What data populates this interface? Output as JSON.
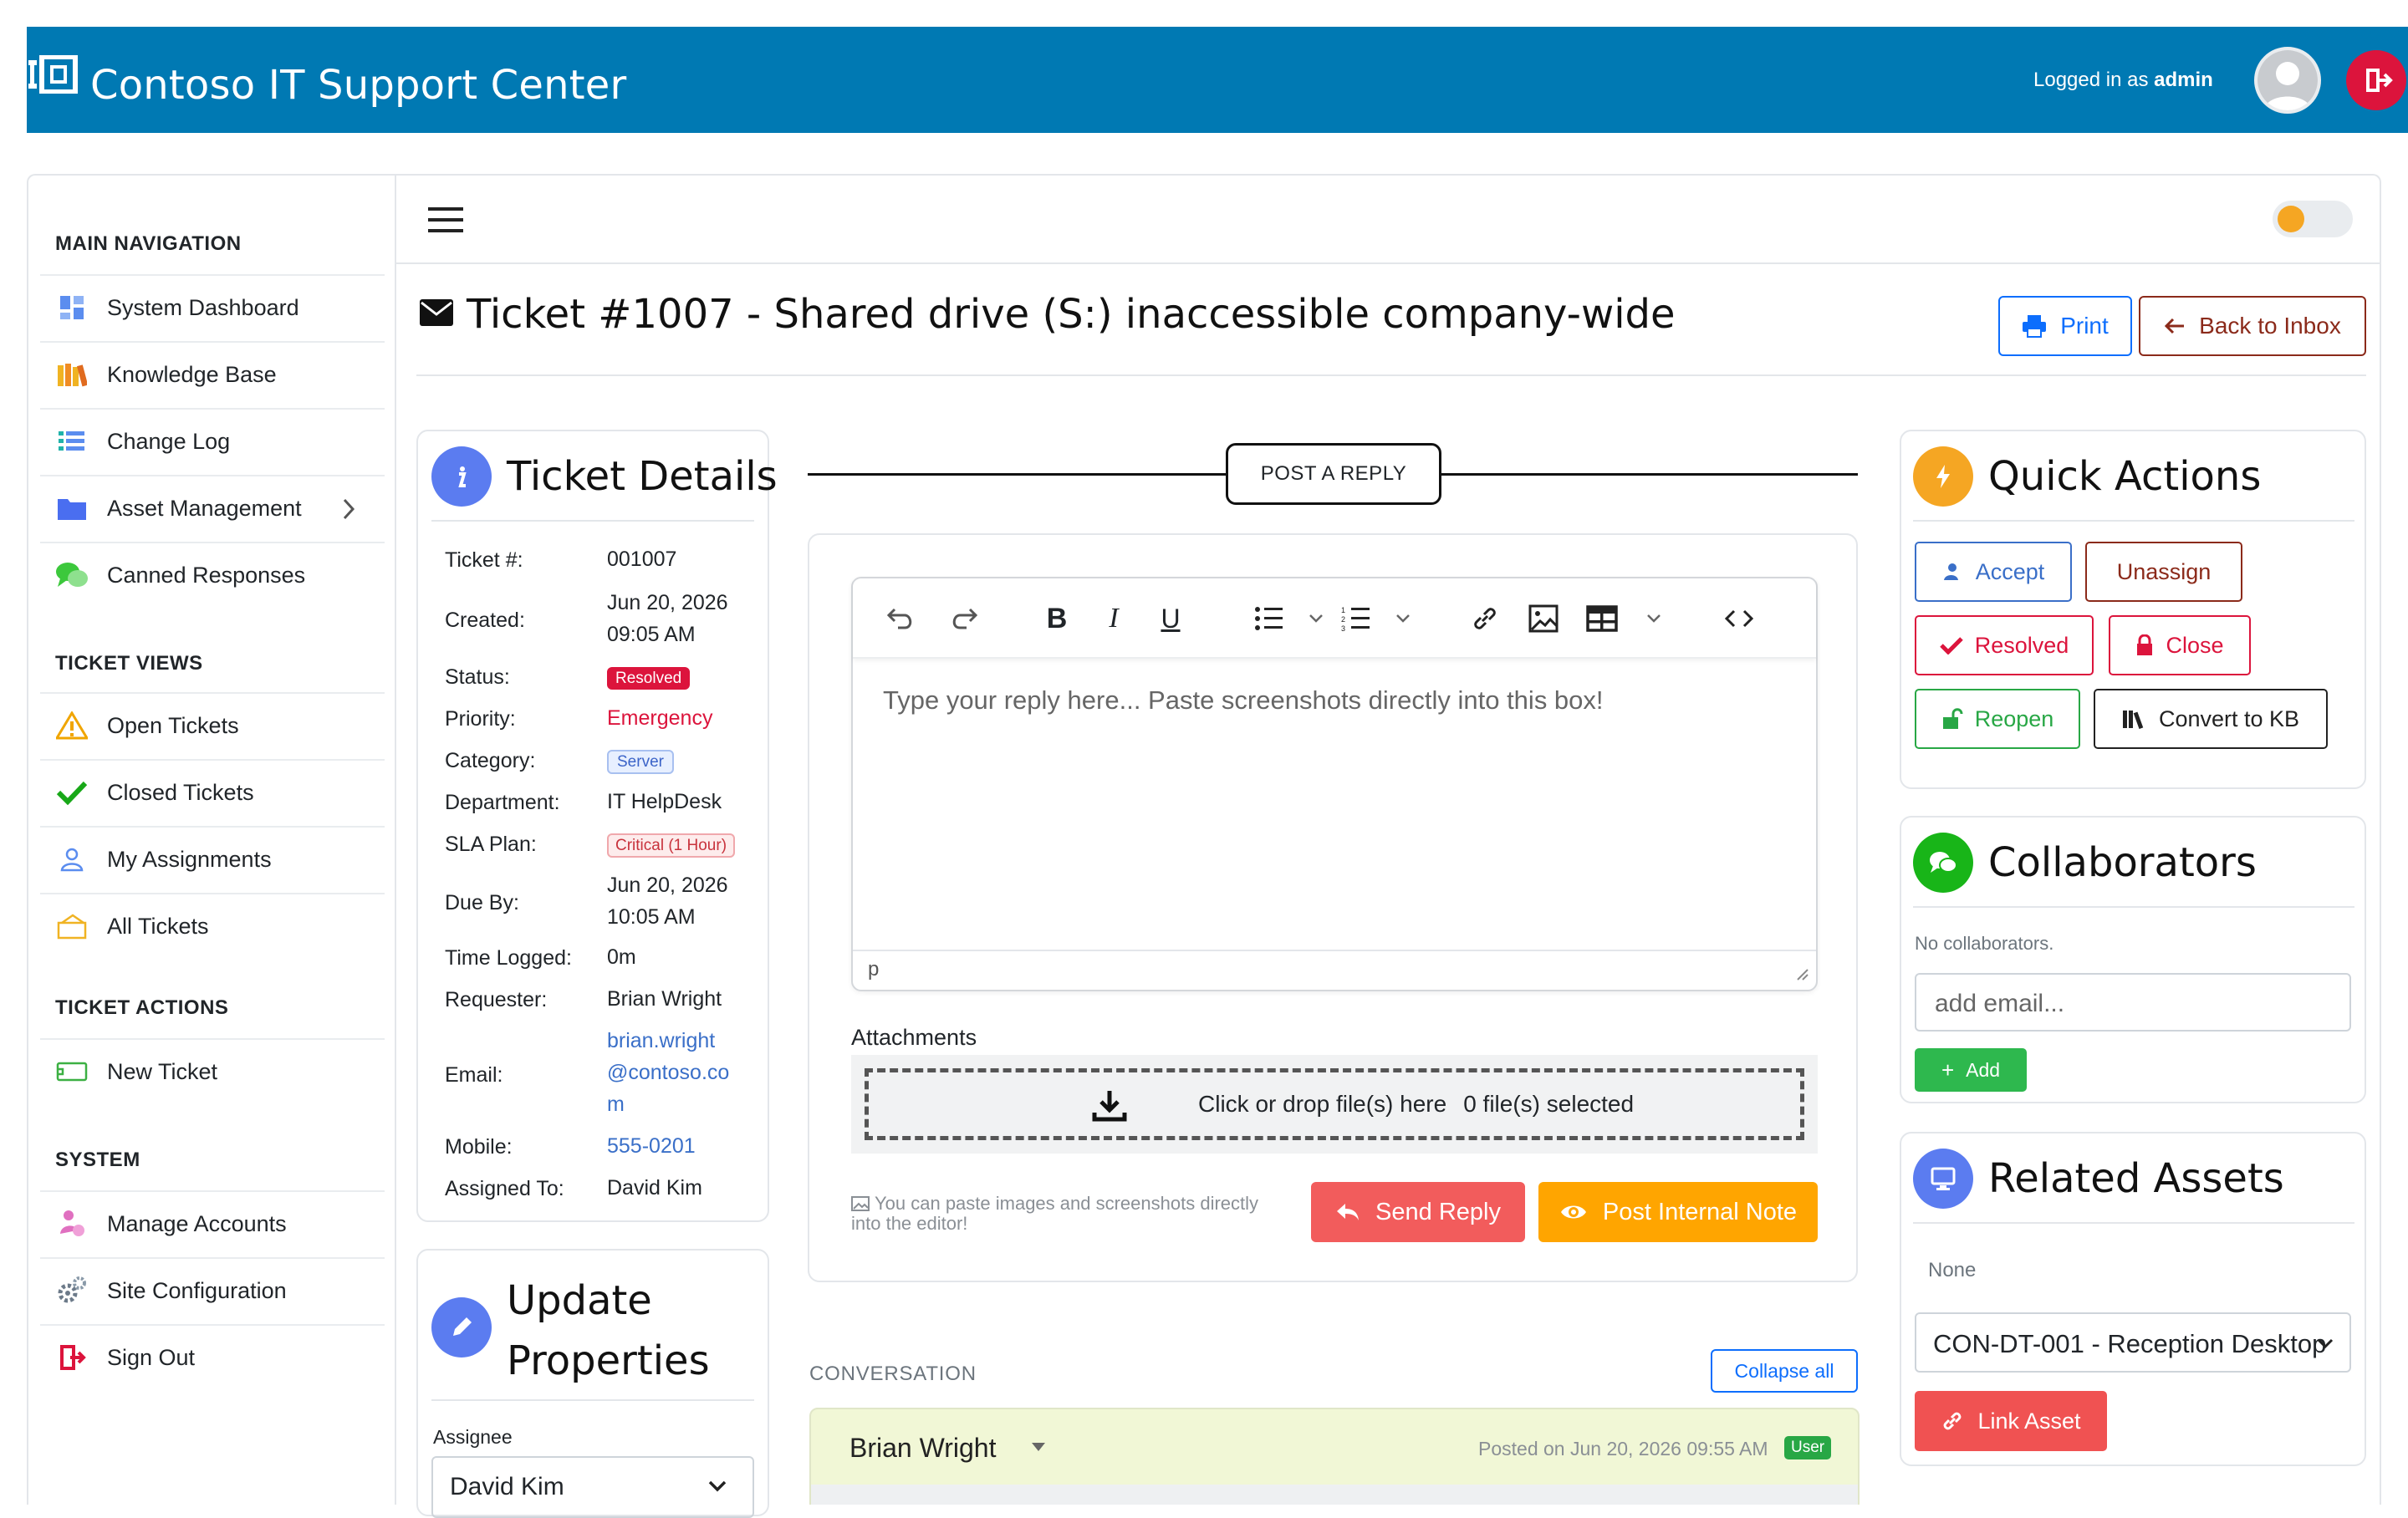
{
  "header": {
    "brand_title": "Contoso IT Support Center",
    "logged_in_prefix": "Logged in as ",
    "logged_in_user": "admin"
  },
  "sidebar": {
    "sections": [
      {
        "title": "MAIN NAVIGATION"
      },
      {
        "title": "TICKET VIEWS"
      },
      {
        "title": "TICKET ACTIONS"
      },
      {
        "title": "SYSTEM"
      }
    ],
    "main_items": [
      {
        "label": "System Dashboard",
        "icon": "dashboard-icon"
      },
      {
        "label": "Knowledge Base",
        "icon": "books-icon"
      },
      {
        "label": "Change Log",
        "icon": "list-icon"
      },
      {
        "label": "Asset Management",
        "icon": "folder-icon"
      },
      {
        "label": "Canned Responses",
        "icon": "chat-bubbles-icon"
      }
    ],
    "view_items": [
      {
        "label": "Open Tickets",
        "icon": "warning-icon"
      },
      {
        "label": "Closed Tickets",
        "icon": "check-icon"
      },
      {
        "label": "My Assignments",
        "icon": "user-icon"
      },
      {
        "label": "All Tickets",
        "icon": "tickets-icon"
      }
    ],
    "action_items": [
      {
        "label": "New Ticket",
        "icon": "ticket-icon"
      }
    ],
    "system_items": [
      {
        "label": "Manage Accounts",
        "icon": "accounts-icon"
      },
      {
        "label": "Site Configuration",
        "icon": "gears-icon"
      },
      {
        "label": "Sign Out",
        "icon": "sign-out-icon"
      }
    ]
  },
  "page": {
    "title": "Ticket #1007 - Shared drive (S:) inaccessible company-wide",
    "print_label": "Print",
    "back_label": "Back to Inbox"
  },
  "ticket_details": {
    "title": "Ticket Details",
    "rows": {
      "ticket_no": {
        "label": "Ticket #:",
        "value": "001007"
      },
      "created": {
        "label": "Created:",
        "value_date": "Jun 20, 2026",
        "value_time": "09:05 AM"
      },
      "status": {
        "label": "Status:",
        "value": "Resolved"
      },
      "priority": {
        "label": "Priority:",
        "value": "Emergency"
      },
      "category": {
        "label": "Category:",
        "value": "Server"
      },
      "department": {
        "label": "Department:",
        "value": "IT HelpDesk"
      },
      "sla": {
        "label": "SLA Plan:",
        "value": "Critical (1 Hour)"
      },
      "due": {
        "label": "Due By:",
        "value_date": "Jun 20, 2026",
        "value_time": "10:05 AM"
      },
      "time_logged": {
        "label": "Time Logged:",
        "value": "0m"
      },
      "requester": {
        "label": "Requester:",
        "value": "Brian Wright"
      },
      "email": {
        "label": "Email:",
        "line1": "brian.wright",
        "line2": "@contoso.co",
        "line3": "m"
      },
      "mobile": {
        "label": "Mobile:",
        "value": "555-0201"
      },
      "assigned": {
        "label": "Assigned To:",
        "value": "David Kim"
      }
    }
  },
  "update_properties": {
    "title_line1": "Update",
    "title_line2": "Properties",
    "assignee_label": "Assignee",
    "assignee_value": "David Kim"
  },
  "reply": {
    "section_label": "POST A REPLY",
    "placeholder": "Type your reply here... Paste screenshots directly into this box!",
    "status_path": "p",
    "attachments_label": "Attachments",
    "dropzone_text": "Click or drop file(s) here",
    "files_selected": "0 file(s) selected",
    "paste_hint_line1": "You can paste images and screenshots directly",
    "paste_hint_line2": "into the editor!",
    "send_label": "Send Reply",
    "internal_note_label": "Post Internal Note"
  },
  "conversation": {
    "label": "CONVERSATION",
    "collapse_label": "Collapse all",
    "messages": [
      {
        "author": "Brian Wright",
        "posted": "Posted on Jun 20, 2026 09:55 AM",
        "badge": "User"
      }
    ]
  },
  "quick_actions": {
    "title": "Quick Actions",
    "accept": "Accept",
    "unassign": "Unassign",
    "resolved": "Resolved",
    "close": "Close",
    "reopen": "Reopen",
    "convert": "Convert to KB"
  },
  "collaborators": {
    "title": "Collaborators",
    "empty_text": "No collaborators.",
    "input_placeholder": "add email...",
    "add_label": "Add"
  },
  "related_assets": {
    "title": "Related Assets",
    "empty_text": "None",
    "select_value": "CON-DT-001 - Reception Desktop",
    "link_label": "Link Asset"
  },
  "colors": {
    "header_bg": "#0079b3",
    "danger": "#dc143c",
    "send_reply": "#f25c5c",
    "internal_note": "#ffa500",
    "success": "#28a745"
  }
}
